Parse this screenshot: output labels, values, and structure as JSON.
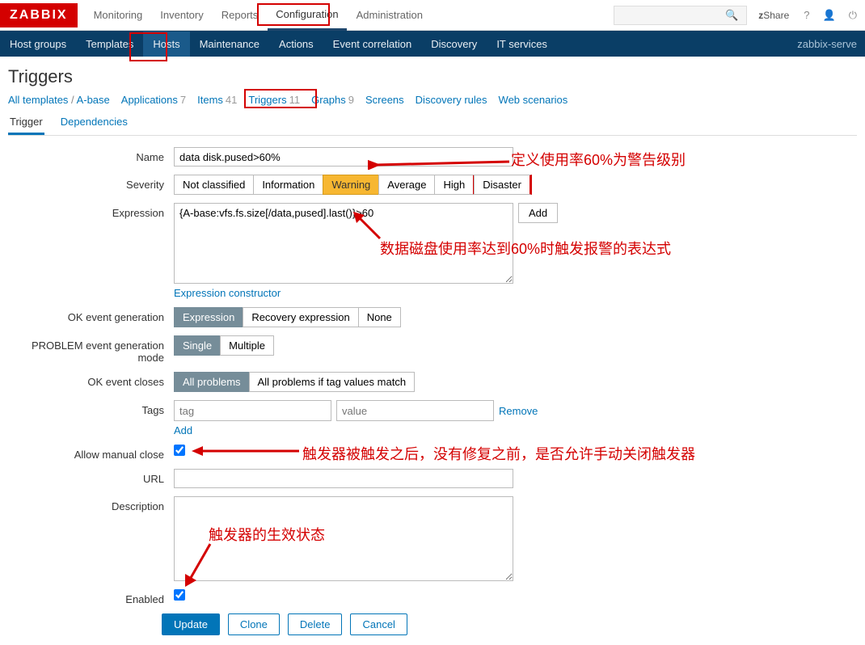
{
  "logo": "ZABBIX",
  "topnav": [
    "Monitoring",
    "Inventory",
    "Reports",
    "Configuration",
    "Administration"
  ],
  "topnav_active": "Configuration",
  "share": "Share",
  "subnav": [
    "Host groups",
    "Templates",
    "Hosts",
    "Maintenance",
    "Actions",
    "Event correlation",
    "Discovery",
    "IT services"
  ],
  "subnav_active": "Hosts",
  "server": "zabbix-serve",
  "page_title": "Triggers",
  "crumbs": {
    "all": "All templates",
    "host": "A-base",
    "apps": {
      "label": "Applications",
      "count": "7"
    },
    "items": {
      "label": "Items",
      "count": "41"
    },
    "triggers": {
      "label": "Triggers",
      "count": "11"
    },
    "graphs": {
      "label": "Graphs",
      "count": "9"
    },
    "screens": "Screens",
    "discovery": "Discovery rules",
    "web": "Web scenarios"
  },
  "tabs": {
    "trigger": "Trigger",
    "deps": "Dependencies"
  },
  "labels": {
    "name": "Name",
    "severity": "Severity",
    "expression": "Expression",
    "okgen": "OK event generation",
    "probgen": "PROBLEM event generation mode",
    "okclose": "OK event closes",
    "tags": "Tags",
    "manual": "Allow manual close",
    "url": "URL",
    "desc": "Description",
    "enabled": "Enabled"
  },
  "fields": {
    "name": "data disk.pused>60%",
    "expression": "{A-base:vfs.fs.size[/data,pused].last()}>60",
    "url": "",
    "description": ""
  },
  "severity": [
    "Not classified",
    "Information",
    "Warning",
    "Average",
    "High",
    "Disaster"
  ],
  "severity_selected": "Warning",
  "expr_link": "Expression constructor",
  "add_btn": "Add",
  "okgen": [
    "Expression",
    "Recovery expression",
    "None"
  ],
  "okgen_selected": "Expression",
  "probgen": [
    "Single",
    "Multiple"
  ],
  "probgen_selected": "Single",
  "okclose": [
    "All problems",
    "All problems if tag values match"
  ],
  "okclose_selected": "All problems",
  "tags": {
    "tag_ph": "tag",
    "value_ph": "value",
    "remove": "Remove",
    "add": "Add"
  },
  "actions": {
    "update": "Update",
    "clone": "Clone",
    "delete": "Delete",
    "cancel": "Cancel"
  },
  "annotations": {
    "a1": "定义使用率60%为警告级别",
    "a2": "数据磁盘使用率达到60%时触发报警的表达式",
    "a3": "触发器被触发之后，没有修复之前，是否允许手动关闭触发器",
    "a4": "触发器的生效状态"
  }
}
